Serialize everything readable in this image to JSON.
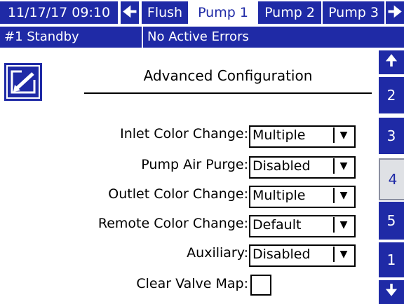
{
  "header": {
    "datetime": "11/17/17 09:10",
    "tabs": [
      {
        "label": "Flush",
        "selected": false
      },
      {
        "label": "Pump 1",
        "selected": true
      },
      {
        "label": "Pump 2",
        "selected": false
      },
      {
        "label": "Pump 3",
        "selected": false
      }
    ]
  },
  "status": {
    "system": "#1 Standby",
    "errors": "No Active Errors"
  },
  "main": {
    "title": "Advanced Configuration",
    "fields": [
      {
        "label": "Inlet Color Change:",
        "value": "Multiple"
      },
      {
        "label": "Pump Air Purge:",
        "value": "Disabled"
      },
      {
        "label": "Outlet Color Change:",
        "value": "Multiple"
      },
      {
        "label": "Remote Color Change:",
        "value": "Default"
      },
      {
        "label": "Auxiliary:",
        "value": "Disabled"
      }
    ],
    "checkbox": {
      "label": "Clear Valve Map:",
      "checked": false
    }
  },
  "side_tabs": [
    {
      "label": "2",
      "selected": false
    },
    {
      "label": "3",
      "selected": false
    },
    {
      "label": "4",
      "selected": true
    },
    {
      "label": "5",
      "selected": false
    },
    {
      "label": "1",
      "selected": false
    }
  ],
  "colors": {
    "accent": "#1f2aa6",
    "selected_tab": "#dfe1e5"
  },
  "icons": [
    "arrow-left-icon",
    "arrow-right-icon",
    "arrow-up-icon",
    "arrow-down-icon",
    "edit-screen-icon",
    "dropdown-arrow-icon"
  ]
}
